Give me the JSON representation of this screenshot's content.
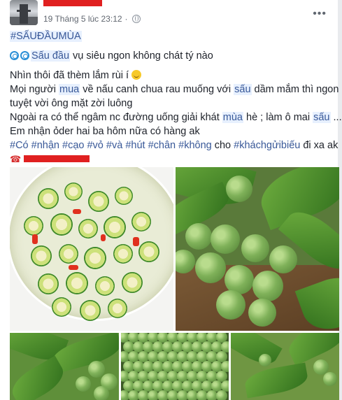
{
  "post": {
    "timestamp": "19 Tháng 5 lúc 23:12",
    "hashtag_title": "#SẤUĐẦUMÙA",
    "line1_prefix": " ",
    "line1_highlight": "Sấu đầu",
    "line1_rest": " vụ siêu ngon không chát tý nào",
    "line2": "Nhìn thôi đã thèm lắm rùi í ",
    "line3_a": "Mọi người ",
    "line3_mua": "mua",
    "line3_b": " về nấu canh chua rau muống với ",
    "line3_sau": "sấu",
    "line3_c": " dầm mắm thì ngon",
    "line4": "tuyệt vời ông mặt zời luông",
    "line5_a": "Ngoài ra có thể ngâm nc đường uống giải khát ",
    "line5_mua": "mùa",
    "line5_b": " hè ; làm ô mai ",
    "line5_sau": "sấu",
    "line5_c": " ...",
    "line6": "Em nhận ỏder hai ba hôm nữa có hàng ak",
    "tags": [
      "#Có",
      "#nhận",
      "#cạo",
      "#vỏ",
      "#và",
      "#hút",
      "#chân",
      "#không"
    ],
    "tag_mid": " cho ",
    "tag_last": "#kháchgửibiếu",
    "tag_tail": " đi xa ak"
  },
  "icons": {
    "globe": "globe-icon",
    "more": "more-options-icon",
    "spiral": "cyclone-emoji-icon",
    "smile": "smiling-face-emoji-icon",
    "phone": "telephone-emoji-icon"
  },
  "colors": {
    "link": "#385898",
    "highlight_bg": "#e7f0fe",
    "redaction": "#e02020"
  }
}
